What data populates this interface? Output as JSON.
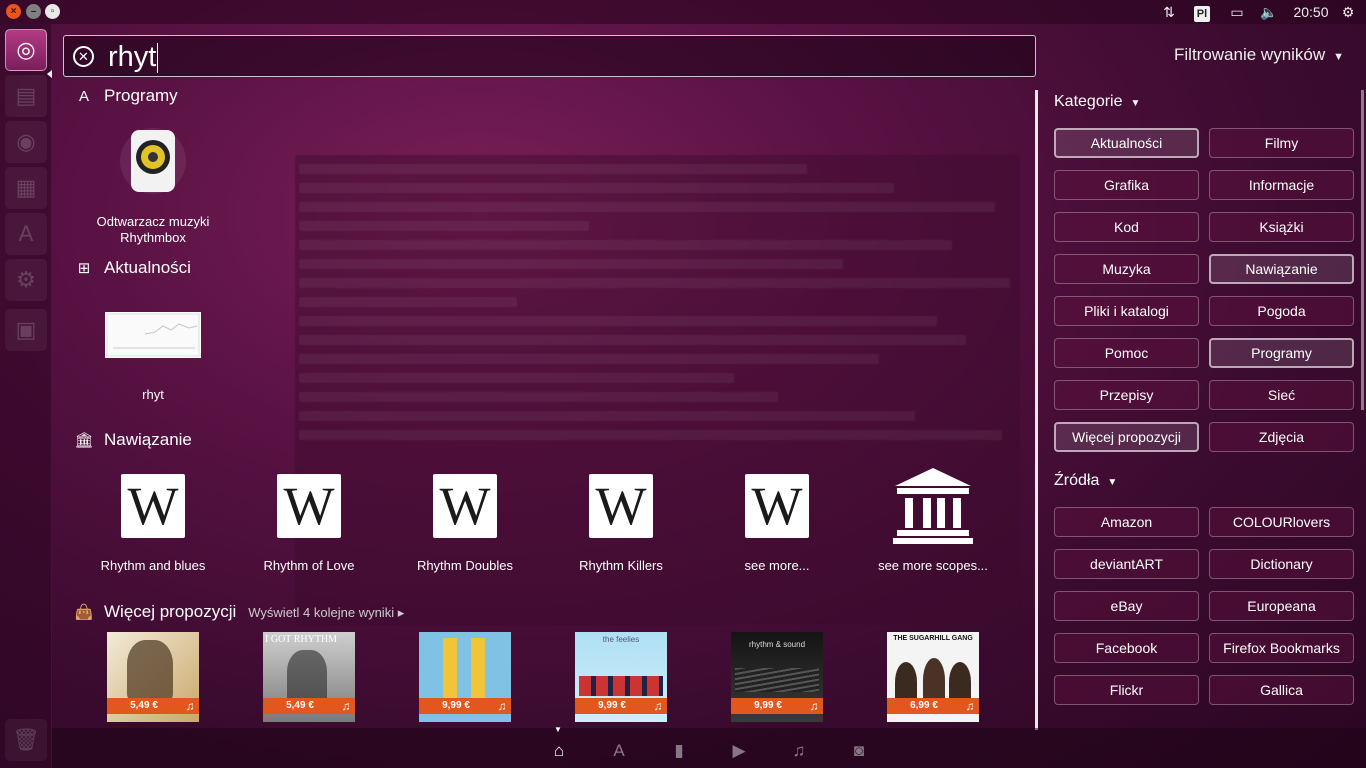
{
  "colors": {
    "accent": "#e2571d",
    "panel_border": "#ffffff"
  },
  "panel": {
    "keyboard_layout": "Pl",
    "clock": "20:50"
  },
  "search": {
    "query": "rhyt"
  },
  "filter_header": "Filtrowanie wyników",
  "sections": {
    "apps": {
      "title": "Programy",
      "icon": "apps-icon",
      "items": [
        {
          "label": "Odtwarzacz muzyki Rhythmbox",
          "icon": "rhythmbox-speaker-icon"
        }
      ]
    },
    "news": {
      "title": "Aktualności",
      "icon": "rss-icon",
      "items": [
        {
          "label": "rhyt"
        }
      ]
    },
    "reference": {
      "title": "Nawiązanie",
      "icon": "library-icon",
      "items": [
        {
          "label": "Rhythm and blues",
          "icon": "wikipedia-icon"
        },
        {
          "label": "Rhythm of Love",
          "icon": "wikipedia-icon"
        },
        {
          "label": "Rhythm Doubles",
          "icon": "wikipedia-icon"
        },
        {
          "label": "Rhythm Killers",
          "icon": "wikipedia-icon"
        },
        {
          "label": "see more...",
          "icon": "wikipedia-icon"
        },
        {
          "label": "see more scopes...",
          "icon": "library-building-icon"
        }
      ]
    },
    "suggestions": {
      "title": "Więcej propozycji",
      "icon": "shopping-bag-icon",
      "more_results": "Wyświetl 4 kolejne wyniki",
      "items": [
        {
          "price": "5,49 €"
        },
        {
          "price": "5,49 €",
          "cover_text": "I GOT RHYTHM"
        },
        {
          "price": "9,99 €"
        },
        {
          "price": "9,99 €",
          "cover_text": "the feelies"
        },
        {
          "price": "9,99 €",
          "cover_text": "rhythm & sound"
        },
        {
          "price": "6,99 €",
          "cover_text": "THE SUGARHILL GANG"
        }
      ]
    }
  },
  "filters": {
    "categories_title": "Kategorie",
    "categories": [
      {
        "label": "Aktualności",
        "active": true
      },
      {
        "label": "Filmy",
        "active": false
      },
      {
        "label": "Grafika",
        "active": false
      },
      {
        "label": "Informacje",
        "active": false
      },
      {
        "label": "Kod",
        "active": false
      },
      {
        "label": "Książki",
        "active": false
      },
      {
        "label": "Muzyka",
        "active": false
      },
      {
        "label": "Nawiązanie",
        "active": true
      },
      {
        "label": "Pliki i katalogi",
        "active": false
      },
      {
        "label": "Pogoda",
        "active": false
      },
      {
        "label": "Pomoc",
        "active": false
      },
      {
        "label": "Programy",
        "active": true
      },
      {
        "label": "Przepisy",
        "active": false
      },
      {
        "label": "Sieć",
        "active": false
      },
      {
        "label": "Więcej propozycji",
        "active": true
      },
      {
        "label": "Zdjęcia",
        "active": false
      }
    ],
    "sources_title": "Źródła",
    "sources": [
      {
        "label": "Amazon"
      },
      {
        "label": "COLOURlovers"
      },
      {
        "label": "deviantART"
      },
      {
        "label": "Dictionary"
      },
      {
        "label": "eBay"
      },
      {
        "label": "Europeana"
      },
      {
        "label": "Facebook"
      },
      {
        "label": "Firefox Bookmarks"
      },
      {
        "label": "Flickr"
      },
      {
        "label": "Gallica"
      }
    ]
  },
  "lenses": [
    {
      "icon": "home-icon",
      "active": true
    },
    {
      "icon": "applications-icon",
      "active": false
    },
    {
      "icon": "files-icon",
      "active": false
    },
    {
      "icon": "video-icon",
      "active": false
    },
    {
      "icon": "music-icon",
      "active": false
    },
    {
      "icon": "photo-icon",
      "active": false
    }
  ]
}
